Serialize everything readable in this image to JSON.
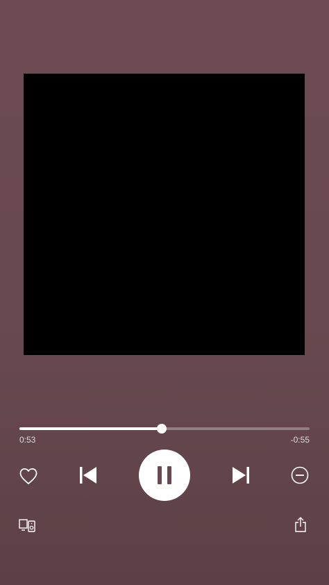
{
  "player": {
    "elapsed": "0:53",
    "remaining": "-0:55",
    "progress_fraction": 0.49
  },
  "icons": {
    "like": "heart-icon",
    "previous": "skip-previous-icon",
    "play_state": "pause-icon",
    "next": "skip-next-icon",
    "hide": "minus-circle-icon",
    "devices": "devices-icon",
    "share": "share-icon"
  },
  "colors": {
    "background": "#6a4a51",
    "album_art": "#000000",
    "foreground": "#ffffff"
  }
}
